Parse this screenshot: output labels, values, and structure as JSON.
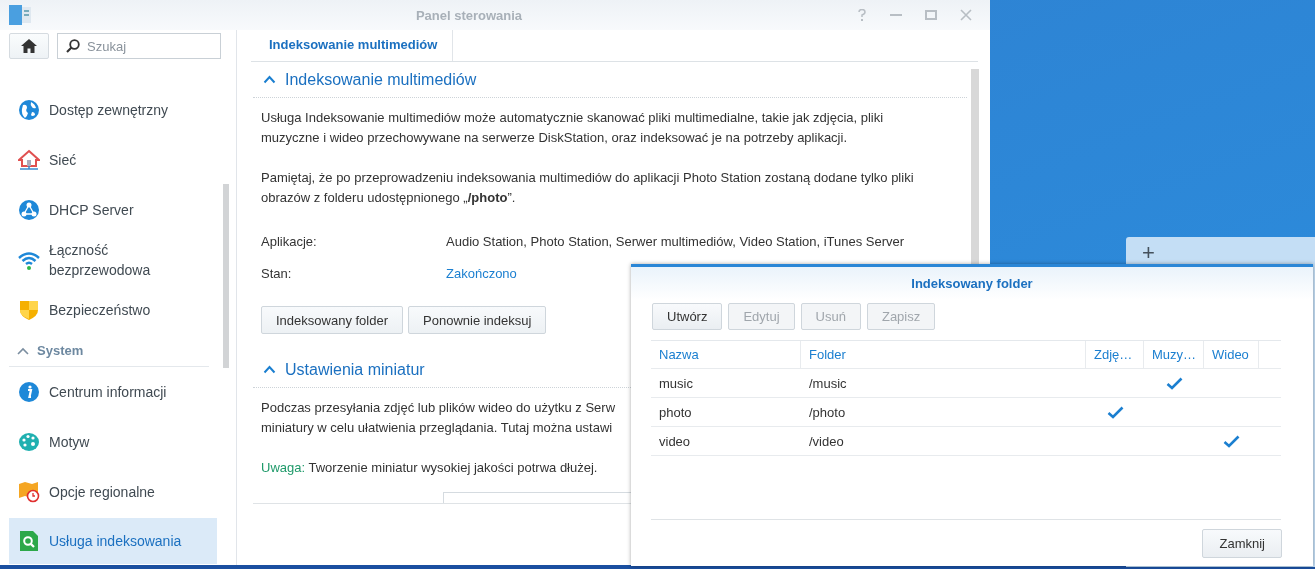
{
  "window": {
    "title": "Panel sterowania"
  },
  "search": {
    "placeholder": "Szukaj"
  },
  "sidebar": {
    "items": [
      {
        "kind": "item",
        "label": "Dostęp zewnętrzny",
        "selected": false
      },
      {
        "kind": "item",
        "label": "Sieć",
        "selected": false
      },
      {
        "kind": "item",
        "label": "DHCP Server",
        "selected": false
      },
      {
        "kind": "item",
        "label": "Łączność bezprzewodowa",
        "selected": false
      },
      {
        "kind": "item",
        "label": "Bezpieczeństwo",
        "selected": false
      },
      {
        "kind": "section",
        "label": "System",
        "expanded": true
      },
      {
        "kind": "item",
        "label": "Centrum informacji",
        "selected": false
      },
      {
        "kind": "item",
        "label": "Motyw",
        "selected": false
      },
      {
        "kind": "item",
        "label": "Opcje regionalne",
        "selected": false
      },
      {
        "kind": "item",
        "label": "Usługa indeksowania",
        "selected": true
      }
    ]
  },
  "tabs": [
    {
      "label": "Indeksowanie multimediów",
      "selected": true
    }
  ],
  "sections": [
    {
      "title": "Indeksowanie multimediów",
      "expanded": true,
      "paragraphs": [
        [
          "Usługa Indeksowanie multimediów może automatycznie skanować pliki multimedialne, takie jak zdjęcia, pliki",
          "muzyczne i wideo przechowywane na serwerze DiskStation, oraz indeksować je na potrzeby aplikacji."
        ],
        [
          "Pamiętaj, że po przeprowadzeniu indeksowania multimediów do aplikacji Photo Station zostaną dodane tylko pliki",
          "obrazów z folderu udostępnionego „**/photo**”."
        ]
      ],
      "fields": [
        {
          "label": "Aplikacje:",
          "value": "Audio Station, Photo Station, Serwer multimediów, Video Station, iTunes Server",
          "kind": "text"
        },
        {
          "label": "Stan:",
          "value": "Zakończono",
          "kind": "status"
        }
      ],
      "buttons": [
        "Indeksowany folder",
        "Ponownie indeksuj"
      ]
    },
    {
      "title": "Ustawienia miniatur",
      "expanded": true,
      "paragraphs": [
        [
          "Podczas przesyłania zdjęć lub plików wideo do użytku z Serw",
          "miniatury w celu ułatwienia przeglądania. Tutaj można ustawi"
        ]
      ],
      "note": {
        "label": "Uwaga:",
        "text": "Tworzenie miniatur wysokiej jakości potrwa dłużej."
      }
    }
  ],
  "dialog": {
    "title": "Indeksowany folder",
    "toolbar": [
      {
        "label": "Utwórz",
        "disabled": false
      },
      {
        "label": "Edytuj",
        "disabled": true
      },
      {
        "label": "Usuń",
        "disabled": true
      },
      {
        "label": "Zapisz",
        "disabled": true
      }
    ],
    "columns": [
      "Nazwa",
      "Folder",
      "Zdję…",
      "Muzy…",
      "Wideo"
    ],
    "rows": [
      {
        "name": "music",
        "folder": "/music",
        "photo": false,
        "music": true,
        "video": false
      },
      {
        "name": "photo",
        "folder": "/photo",
        "photo": true,
        "music": false,
        "video": false
      },
      {
        "name": "video",
        "folder": "/video",
        "photo": false,
        "music": false,
        "video": true
      }
    ],
    "close_button": "Zamknij"
  },
  "widget": {
    "add_label": "+"
  }
}
